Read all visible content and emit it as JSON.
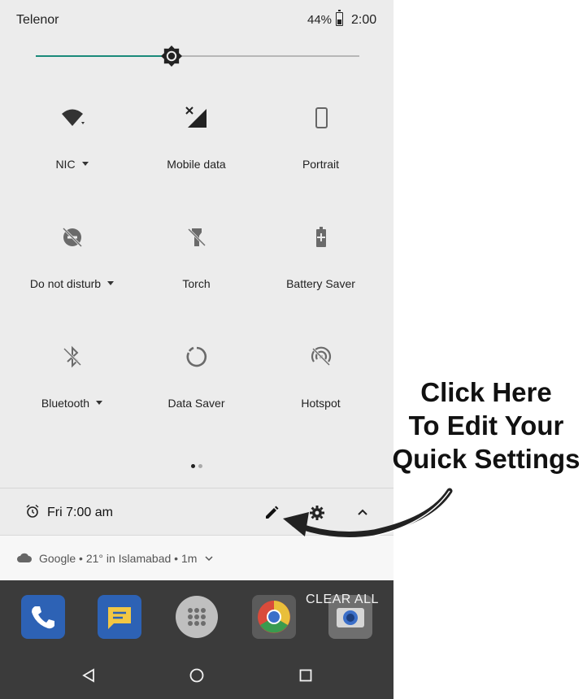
{
  "status_bar": {
    "carrier": "Telenor",
    "battery_percent": "44%",
    "time": "2:00"
  },
  "brightness": {
    "level": 0.42,
    "accent_color": "#1a8a7a"
  },
  "tiles": [
    {
      "label": "NIC",
      "icon": "wifi-icon",
      "has_dropdown": true
    },
    {
      "label": "Mobile data",
      "icon": "mobile-data-off-icon",
      "has_dropdown": false
    },
    {
      "label": "Portrait",
      "icon": "portrait-icon",
      "has_dropdown": false
    },
    {
      "label": "Do not disturb",
      "icon": "do-not-disturb-off-icon",
      "has_dropdown": true
    },
    {
      "label": "Torch",
      "icon": "flashlight-off-icon",
      "has_dropdown": false
    },
    {
      "label": "Battery Saver",
      "icon": "battery-saver-icon",
      "has_dropdown": false
    },
    {
      "label": "Bluetooth",
      "icon": "bluetooth-off-icon",
      "has_dropdown": true
    },
    {
      "label": "Data Saver",
      "icon": "data-saver-icon",
      "has_dropdown": false
    },
    {
      "label": "Hotspot",
      "icon": "hotspot-off-icon",
      "has_dropdown": false
    }
  ],
  "pager": {
    "pages": 2,
    "current": 1
  },
  "footer": {
    "alarm": "Fri 7:00 am"
  },
  "notification": {
    "text": "Google • 21° in Islamabad • 1m"
  },
  "dock": {
    "clear_all": "CLEAR ALL",
    "apps": [
      "phone-icon",
      "messages-icon",
      "app-drawer-icon",
      "chrome-icon",
      "camera-icon"
    ]
  },
  "callout": {
    "lines": [
      "Click Here",
      "To Edit Your",
      "Quick Settings"
    ]
  }
}
